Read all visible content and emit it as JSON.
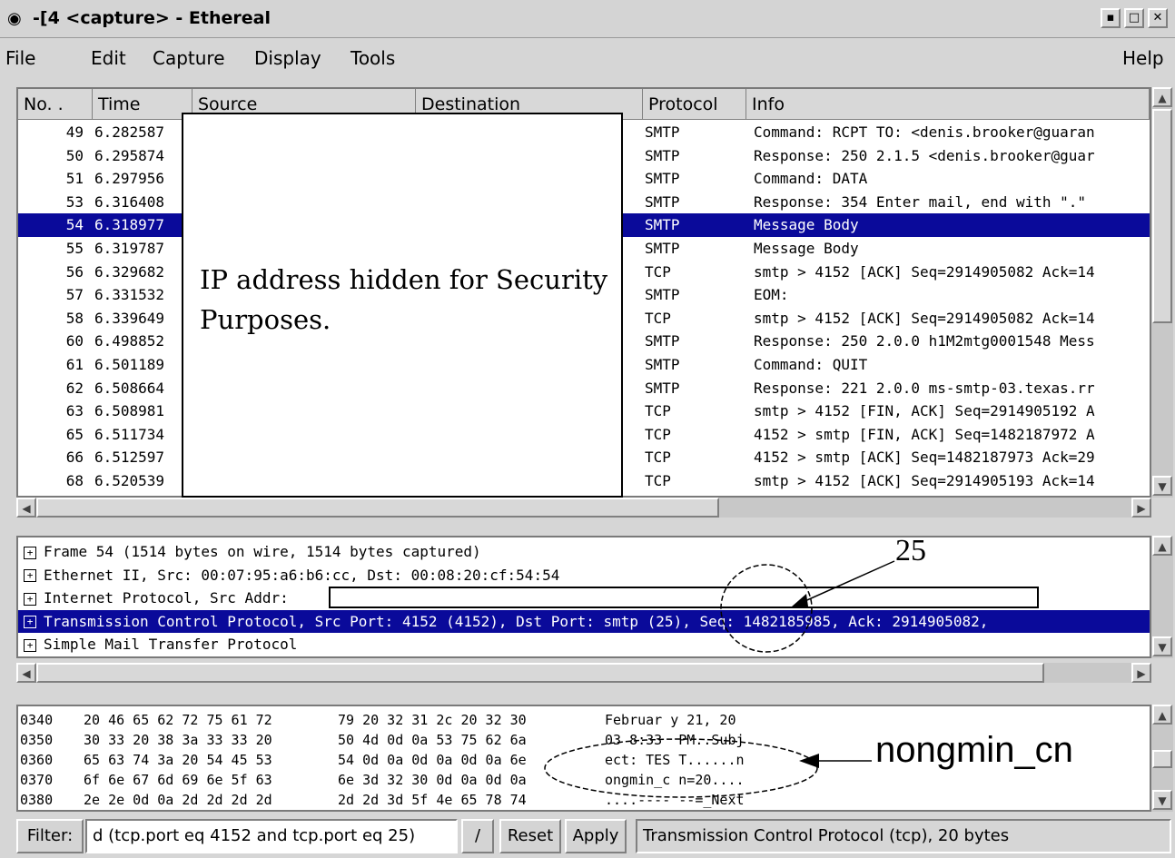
{
  "window": {
    "title": "-[4 <capture> - Ethereal",
    "title_icon": "app-icon",
    "buttons": [
      "▪",
      "□",
      "✕"
    ]
  },
  "menu": {
    "file": "File",
    "edit": "Edit",
    "capture": "Capture",
    "display": "Display",
    "tools": "Tools",
    "help": "Help"
  },
  "packet_list": {
    "columns": [
      "No. .",
      "Time",
      "Source",
      "Destination",
      "Protocol",
      "Info"
    ],
    "rows": [
      {
        "no": "49",
        "time": "6.282587",
        "protocol": "SMTP",
        "info": "Command: RCPT TO: <denis.brooker@guaran"
      },
      {
        "no": "50",
        "time": "6.295874",
        "protocol": "SMTP",
        "info": "Response: 250 2.1.5 <denis.brooker@guar"
      },
      {
        "no": "51",
        "time": "6.297956",
        "protocol": "SMTP",
        "info": "Command: DATA"
      },
      {
        "no": "53",
        "time": "6.316408",
        "protocol": "SMTP",
        "info": "Response: 354 Enter mail, end with \".\""
      },
      {
        "no": "54",
        "time": "6.318977",
        "protocol": "SMTP",
        "info": "Message Body"
      },
      {
        "no": "55",
        "time": "6.319787",
        "protocol": "SMTP",
        "info": "Message Body"
      },
      {
        "no": "56",
        "time": "6.329682",
        "protocol": "TCP",
        "info": "smtp > 4152 [ACK] Seq=2914905082 Ack=14"
      },
      {
        "no": "57",
        "time": "6.331532",
        "protocol": "SMTP",
        "info": "EOM:"
      },
      {
        "no": "58",
        "time": "6.339649",
        "protocol": "TCP",
        "info": "smtp > 4152 [ACK] Seq=2914905082 Ack=14"
      },
      {
        "no": "60",
        "time": "6.498852",
        "protocol": "SMTP",
        "info": "Response: 250 2.0.0 h1M2mtg0001548 Mess"
      },
      {
        "no": "61",
        "time": "6.501189",
        "protocol": "SMTP",
        "info": "Command: QUIT"
      },
      {
        "no": "62",
        "time": "6.508664",
        "protocol": "SMTP",
        "info": "Response: 221 2.0.0 ms-smtp-03.texas.rr"
      },
      {
        "no": "63",
        "time": "6.508981",
        "protocol": "TCP",
        "info": "smtp > 4152 [FIN, ACK] Seq=2914905192 A"
      },
      {
        "no": "65",
        "time": "6.511734",
        "protocol": "TCP",
        "info": "4152 > smtp [FIN, ACK] Seq=1482187972 A"
      },
      {
        "no": "66",
        "time": "6.512597",
        "protocol": "TCP",
        "info": "4152 > smtp [ACK] Seq=1482187973 Ack=29"
      },
      {
        "no": "68",
        "time": "6.520539",
        "protocol": "TCP",
        "info": "smtp > 4152 [ACK] Seq=2914905193 Ack=14"
      }
    ],
    "selected_index": 4,
    "ip_hidden_note": "IP address hidden for Security Purposes."
  },
  "detail_tree": {
    "rows": [
      "Frame 54 (1514 bytes on wire, 1514 bytes captured)",
      "Ethernet II, Src: 00:07:95:a6:b6:cc, Dst: 00:08:20:cf:54:54",
      "Internet Protocol, Src Addr:",
      "Transmission Control Protocol, Src Port: 4152 (4152), Dst Port: smtp (25), Seq: 1482185985, Ack: 2914905082,",
      "Simple Mail Transfer Protocol"
    ],
    "selected_index": 3,
    "expander": "⊞"
  },
  "hex_pane": {
    "rows": [
      {
        "offset": "0340",
        "bytes1": "20 46 65 62 72 75 61 72",
        "bytes2": "79 20 32 31 2c 20 32 30",
        "ascii": "Februar y 21, 20"
      },
      {
        "offset": "0350",
        "bytes1": "30 33 20 38 3a 33 33 20",
        "bytes2": "50 4d 0d 0a 53 75 62 6a",
        "ascii": "03 8:33  PM..Subj"
      },
      {
        "offset": "0360",
        "bytes1": "65 63 74 3a 20 54 45 53",
        "bytes2": "54 0d 0a 0d 0a 0d 0a 6e",
        "ascii": "ect: TES T......n"
      },
      {
        "offset": "0370",
        "bytes1": "6f 6e 67 6d 69 6e 5f 63",
        "bytes2": "6e 3d 32 30 0d 0a 0d 0a",
        "ascii": "ongmin_c n=20...."
      },
      {
        "offset": "0380",
        "bytes1": "2e 2e 0d 0a 2d 2d 2d 2d",
        "bytes2": "2d 2d 3d 5f 4e 65 78 74",
        "ascii": "....---- --=_Next"
      }
    ]
  },
  "filter_bar": {
    "label": "Filter:",
    "value": "d (tcp.port eq 4152 and tcp.port eq 25)",
    "edit_button": "/",
    "reset": "Reset",
    "apply": "Apply",
    "status": "Transmission Control Protocol (tcp), 20 bytes"
  },
  "annotations": {
    "port_label": "25",
    "keyword_label": "nongmin_cn"
  },
  "colors": {
    "selection": "#0a0a9a",
    "pane_background": "#ffffff",
    "window_background": "#d6d6d6"
  }
}
